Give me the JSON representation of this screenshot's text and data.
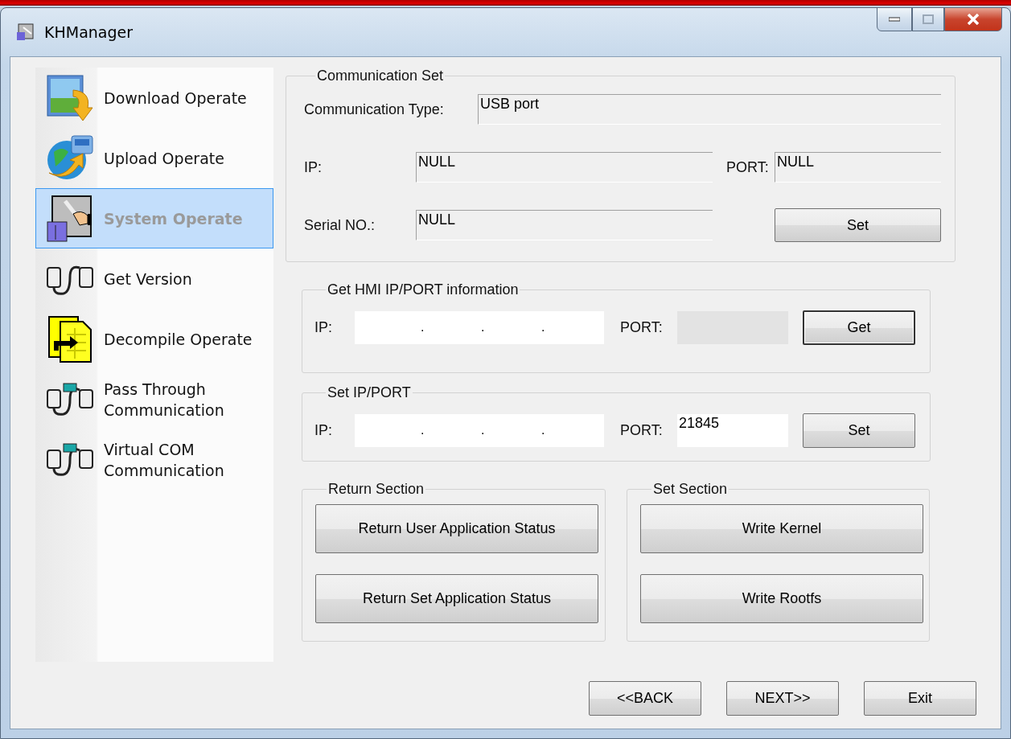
{
  "window": {
    "title": "KHManager"
  },
  "sidebar": {
    "items": [
      {
        "label": "Download Operate",
        "kind": "download",
        "selected": false
      },
      {
        "label": "Upload Operate",
        "kind": "upload",
        "selected": false
      },
      {
        "label": "System Operate",
        "kind": "system",
        "selected": true
      },
      {
        "label": "Get Version",
        "kind": "cable",
        "selected": false
      },
      {
        "label": "Decompile Operate",
        "kind": "decompile",
        "selected": false
      },
      {
        "label": "Pass Through Communication",
        "kind": "cable-screen",
        "selected": false
      },
      {
        "label": "Virtual COM Communication",
        "kind": "cable-screen",
        "selected": false
      }
    ]
  },
  "communication_set": {
    "title": "Communication Set",
    "type_label": "Communication Type:",
    "type_value": "USB port",
    "ip_label": "IP:",
    "ip_value": "NULL",
    "port_label": "PORT:",
    "port_value": "NULL",
    "serial_label": "Serial NO.:",
    "serial_value": "NULL",
    "button": "Set"
  },
  "get_hmi": {
    "title": "Get HMI IP/PORT information",
    "ip_label": "IP:",
    "ip_separators": [
      ".",
      ".",
      "."
    ],
    "port_label": "PORT:",
    "port_disabled": true,
    "button": {
      "label": "Get",
      "focused": true
    }
  },
  "set_ip": {
    "title": "Set IP/PORT",
    "ip_label": "IP:",
    "ip_separators": [
      ".",
      ".",
      "."
    ],
    "port_label": "PORT:",
    "port_value": "21845",
    "port_disabled": false,
    "button": {
      "label": "Set",
      "focused": false
    }
  },
  "return_section": {
    "title": "Return Section",
    "buttons": [
      "Return User Application Status",
      "Return Set Application Status"
    ]
  },
  "set_section": {
    "title": "Set Section",
    "buttons": [
      "Write Kernel",
      "Write Rootfs"
    ]
  },
  "footer_buttons": [
    "<<BACK",
    "NEXT>>",
    "Exit"
  ]
}
